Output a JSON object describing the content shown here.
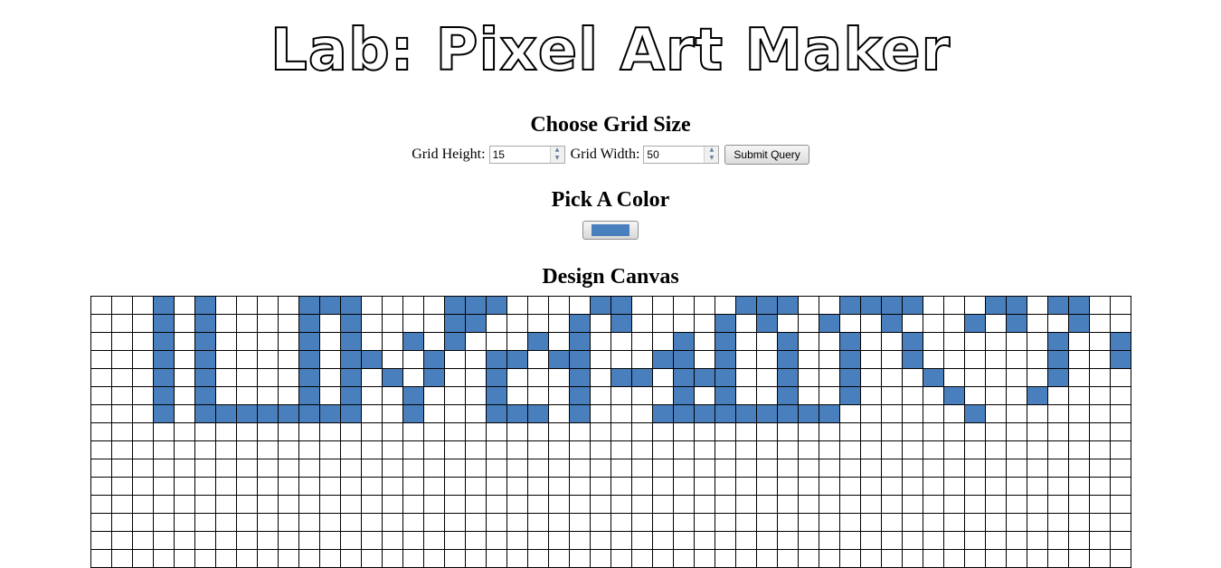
{
  "title": "Lab: Pixel Art Maker",
  "grid_section": {
    "heading": "Choose Grid Size",
    "height_label": "Grid Height:",
    "height_value": "15",
    "width_label": "Grid Width:",
    "width_value": "50",
    "submit_label": "Submit Query"
  },
  "color_section": {
    "heading": "Pick A Color",
    "selected_color": "#4a7fbd"
  },
  "canvas_section": {
    "heading": "Design Canvas",
    "rows": 15,
    "cols": 50,
    "visible_rows": 15,
    "cell_color": "#ffffff",
    "painted_color": "#4a7fbd",
    "painted": [
      "...X.X....XXX....XXX....XX.....XXX..XXXX...XX.XX..",
      "...X.X....X.X....XX....X.X....X.X..X..X...X.X..X..",
      "...X.X....X.X..X.X...X.X....X.X..X..X..X......X..X",
      "...X.X....X.XX..X..XX.XX...XX.X..X..X..X......X..X",
      "...X.X....X.X.X.X..X...X.XX.XXX..X..X...X.....X...",
      "...X.X....X.X..X...X...X....X.X..X..X....X...X....",
      "...X.XXXXXXXX..X...XXX.X...XXXXXXXXX......X......."
    ]
  }
}
